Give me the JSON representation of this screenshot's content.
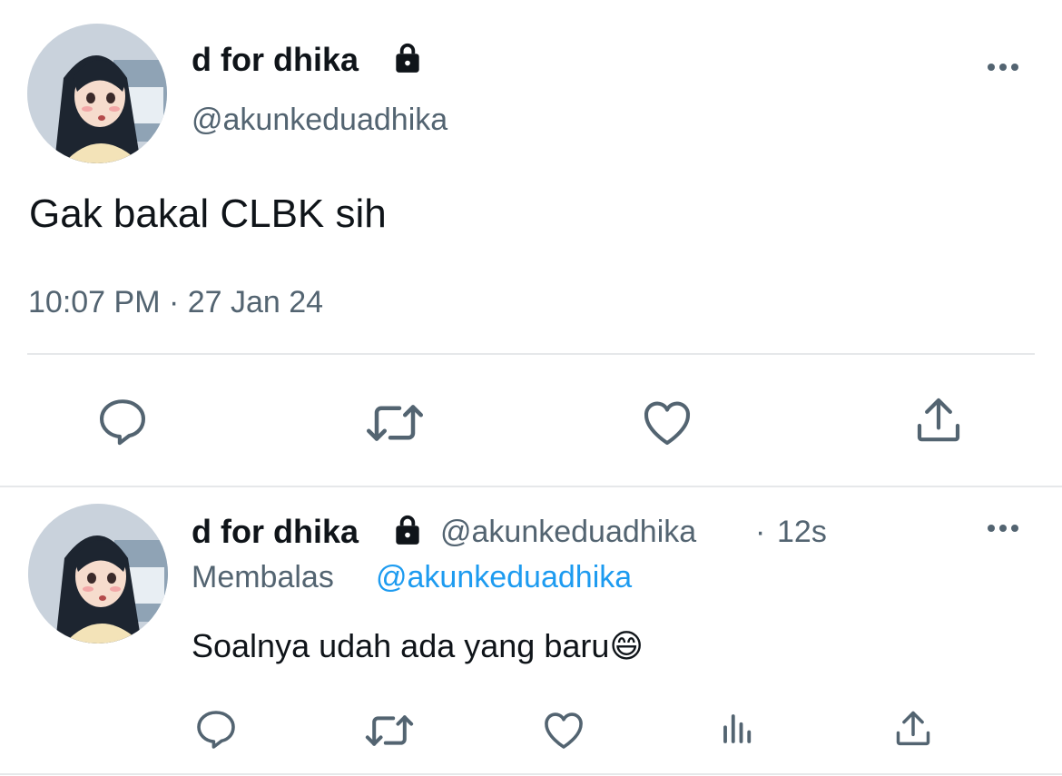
{
  "main_tweet": {
    "display_name": "d for dhika",
    "handle": "@akunkeduadhika",
    "text": "Gak bakal CLBK sih",
    "timestamp": "10:07 PM · 27 Jan 24",
    "protected_icon": "lock-icon",
    "actions": [
      "reply-icon",
      "retweet-icon",
      "like-icon",
      "share-icon"
    ]
  },
  "reply_tweet": {
    "display_name": "d for dhika",
    "handle": "@akunkeduadhika",
    "separator": "·",
    "time_ago": "12s",
    "replying_label": "Membalas",
    "replying_to": "@akunkeduadhika",
    "text": "Soalnya udah ada yang baru",
    "emoji": "😄",
    "protected_icon": "lock-icon",
    "actions": [
      "reply-icon",
      "retweet-icon",
      "like-icon",
      "analytics-icon",
      "share-icon"
    ]
  },
  "colors": {
    "text": "#0f1419",
    "secondary": "#536471",
    "link": "#1d9bf0",
    "divider": "#e6e8ea"
  }
}
